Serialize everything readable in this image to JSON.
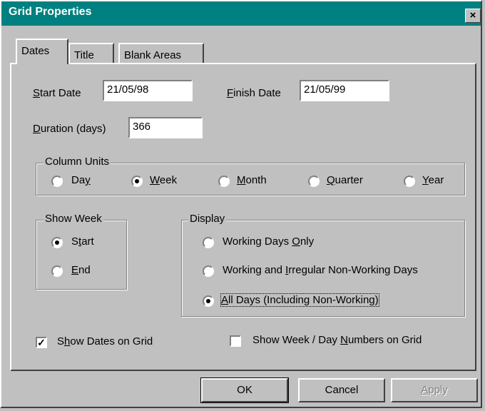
{
  "window": {
    "title": "Grid Properties",
    "close_glyph": "×"
  },
  "tabs": [
    {
      "label": "Dates",
      "active": true
    },
    {
      "label": "Title",
      "active": false
    },
    {
      "label": "Blank Areas",
      "active": false
    }
  ],
  "dates": {
    "start_label_mn": "S",
    "start_label_rest": "tart Date",
    "start_value": "21/05/98",
    "finish_label_mn": "F",
    "finish_label_rest": "inish Date",
    "finish_value": "21/05/99",
    "duration_label_mn": "D",
    "duration_label_rest": "uration (days)",
    "duration_value": "366"
  },
  "column_units": {
    "legend": "Column Units",
    "options": [
      {
        "pre": "Da",
        "mn": "y",
        "post": "",
        "selected": false
      },
      {
        "pre": "",
        "mn": "W",
        "post": "eek",
        "selected": true
      },
      {
        "pre": "",
        "mn": "M",
        "post": "onth",
        "selected": false
      },
      {
        "pre": "",
        "mn": "Q",
        "post": "uarter",
        "selected": false
      },
      {
        "pre": "",
        "mn": "Y",
        "post": "ear",
        "selected": false
      }
    ]
  },
  "show_week": {
    "legend": "Show Week",
    "options": [
      {
        "pre": "S",
        "mn": "t",
        "post": "art",
        "selected": true
      },
      {
        "pre": "",
        "mn": "E",
        "post": "nd",
        "selected": false
      }
    ]
  },
  "display": {
    "legend": "Display",
    "options": [
      {
        "pre": "Working Days ",
        "mn": "O",
        "post": "nly",
        "selected": false
      },
      {
        "pre": "Working and ",
        "mn": "I",
        "post": "rregular Non-Working Days",
        "selected": false
      },
      {
        "pre": "",
        "mn": "A",
        "post": "ll Days (Including Non-Working)",
        "selected": true
      }
    ]
  },
  "checks": {
    "show_dates": {
      "pre": "S",
      "mn": "h",
      "post": "ow Dates on Grid",
      "checked": true
    },
    "show_numbers": {
      "pre": "Show Week / Day ",
      "mn": "N",
      "post": "umbers on Grid",
      "checked": false
    }
  },
  "buttons": {
    "ok": "OK",
    "cancel": "Cancel",
    "apply_mn": "A",
    "apply_rest": "pply",
    "apply_enabled": false
  },
  "colors": {
    "titlebar": "#008080",
    "face": "#c0c0c0"
  }
}
